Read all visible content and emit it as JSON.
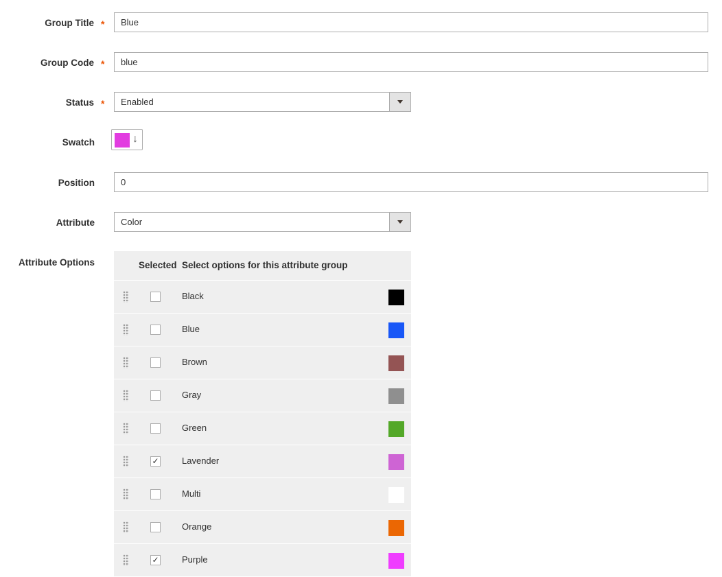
{
  "form": {
    "group_title": {
      "label": "Group Title",
      "required": "*",
      "value": "Blue"
    },
    "group_code": {
      "label": "Group Code",
      "required": "*",
      "value": "blue"
    },
    "status": {
      "label": "Status",
      "required": "*",
      "value": "Enabled"
    },
    "swatch": {
      "label": "Swatch",
      "color": "#e23ce0",
      "arrow": "↓"
    },
    "position": {
      "label": "Position",
      "value": "0"
    },
    "attribute": {
      "label": "Attribute",
      "value": "Color"
    },
    "attribute_options": {
      "label": "Attribute Options",
      "col_selected": "Selected",
      "col_options": "Select options for this attribute group",
      "rows": [
        {
          "name": "Black",
          "checked": false,
          "color": "#000000"
        },
        {
          "name": "Blue",
          "checked": false,
          "color": "#1857f7"
        },
        {
          "name": "Brown",
          "checked": false,
          "color": "#945454"
        },
        {
          "name": "Gray",
          "checked": false,
          "color": "#8f8f8f"
        },
        {
          "name": "Green",
          "checked": false,
          "color": "#53a828"
        },
        {
          "name": "Lavender",
          "checked": true,
          "color": "#ce64d4"
        },
        {
          "name": "Multi",
          "checked": false,
          "color": "#ffffff"
        },
        {
          "name": "Orange",
          "checked": false,
          "color": "#eb6703"
        },
        {
          "name": "Purple",
          "checked": true,
          "color": "#ef3dff"
        }
      ]
    }
  },
  "accent_color": "#eb5202"
}
